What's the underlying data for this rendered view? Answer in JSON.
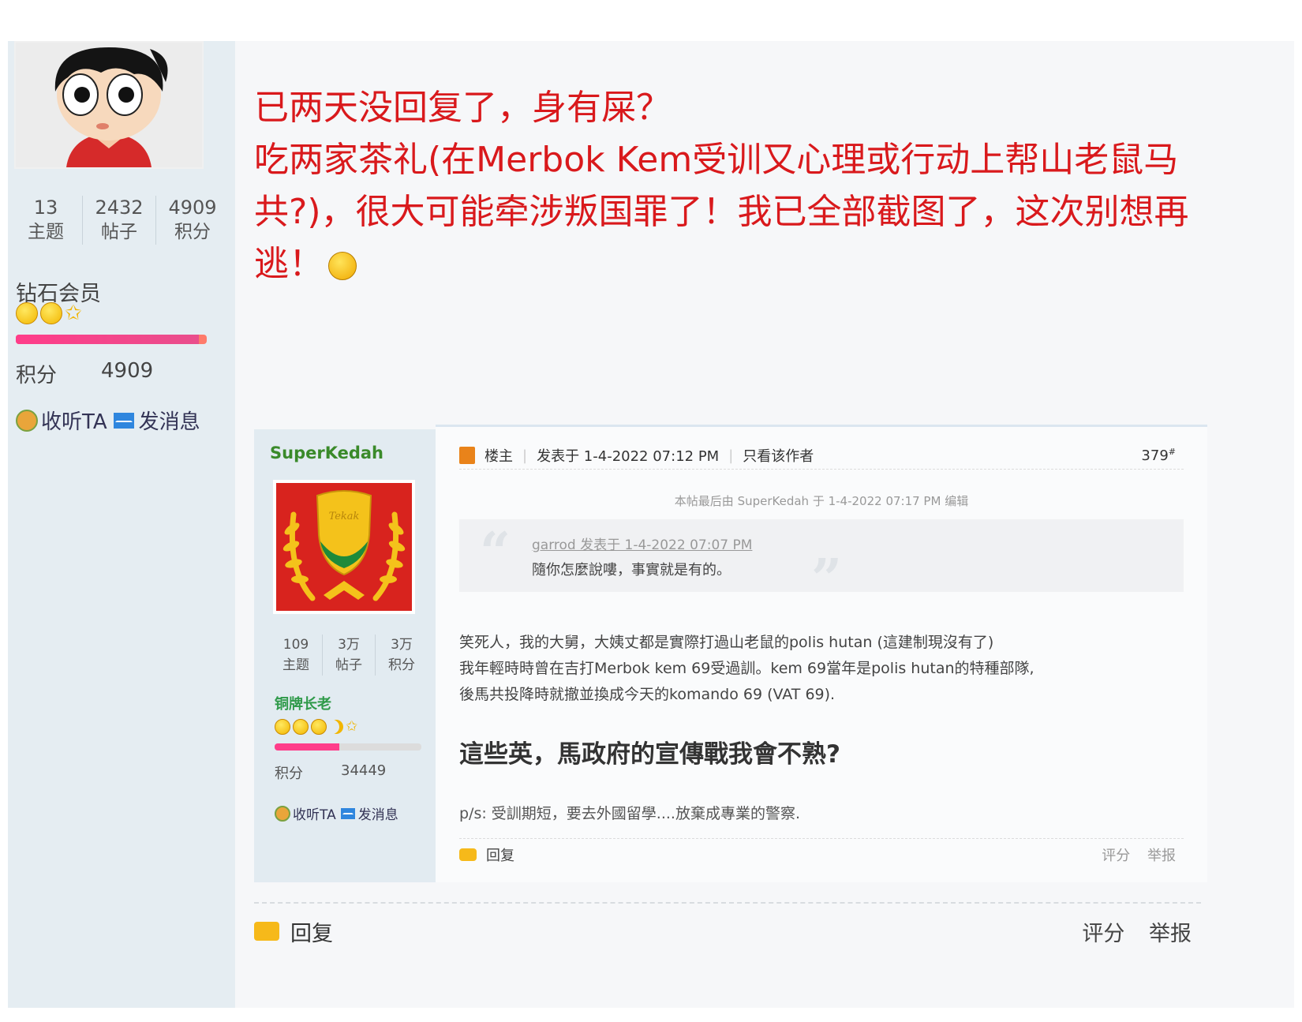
{
  "outer_post": {
    "stats": [
      {
        "num": "13",
        "label": "主题"
      },
      {
        "num": "2432",
        "label": "帖子"
      },
      {
        "num": "4909",
        "label": "积分"
      }
    ],
    "rank": "钻石会员",
    "progress": 0.96,
    "points_label": "积分",
    "points_value": "4909",
    "follow_label": "收听TA",
    "message_label": "发消息",
    "message_lines": [
      "已两天没回复了，身有屎？",
      "吃两家茶礼(在Merbok Kem受训又心理或行动上帮山老鼠马共?)，很大可能牵涉叛国罪了！我已全部截图了，这次别想再逃！"
    ],
    "footer": {
      "reply": "回复",
      "rate": "评分",
      "report": "举报"
    }
  },
  "embedded_post": {
    "username": "SuperKedah",
    "stats": [
      {
        "num": "109",
        "label": "主题"
      },
      {
        "num": "3万",
        "label": "帖子"
      },
      {
        "num": "3万",
        "label": "积分"
      }
    ],
    "rank": "铜牌长老",
    "progress": 0.44,
    "points_label": "积分",
    "points_value": "34449",
    "follow_label": "收听TA",
    "message_label": "发消息",
    "author_tag": "楼主",
    "posted_at": "发表于 1-4-2022 07:12 PM",
    "only_author": "只看该作者",
    "floor": "379",
    "floor_suffix": "#",
    "edited_note": "本帖最后由 SuperKedah 于 1-4-2022 07:17 PM 编辑",
    "quote_author": "garrod 发表于 1-4-2022 07:07 PM",
    "quote_text": "隨你怎麼說嘍，事實就是有的。",
    "body_lines": [
      "笑死人，我的大舅，大姨丈都是實際打過山老鼠的polis hutan (這建制現沒有了)",
      "我年輕時時曾在吉打Merbok kem 69受過訓。kem 69當年是polis hutan的特種部隊,",
      "後馬共投降時就撤並換成今天的komando 69 (VAT 69)."
    ],
    "headline": "這些英，馬政府的宣傳戰我會不熟?",
    "ps": "p/s: 受訓期短，要去外國留學....放棄成專業的警察.",
    "footer": {
      "reply": "回复",
      "rate": "评分",
      "report": "举报"
    },
    "avatar_text": "Tekak"
  },
  "colors": {
    "sidebar_bg": "#e5edf2",
    "content_bg": "#f6f7f9",
    "message_red": "#d9191c",
    "username_green": "#3a8a2a",
    "rank_green": "#2f9a4a"
  }
}
